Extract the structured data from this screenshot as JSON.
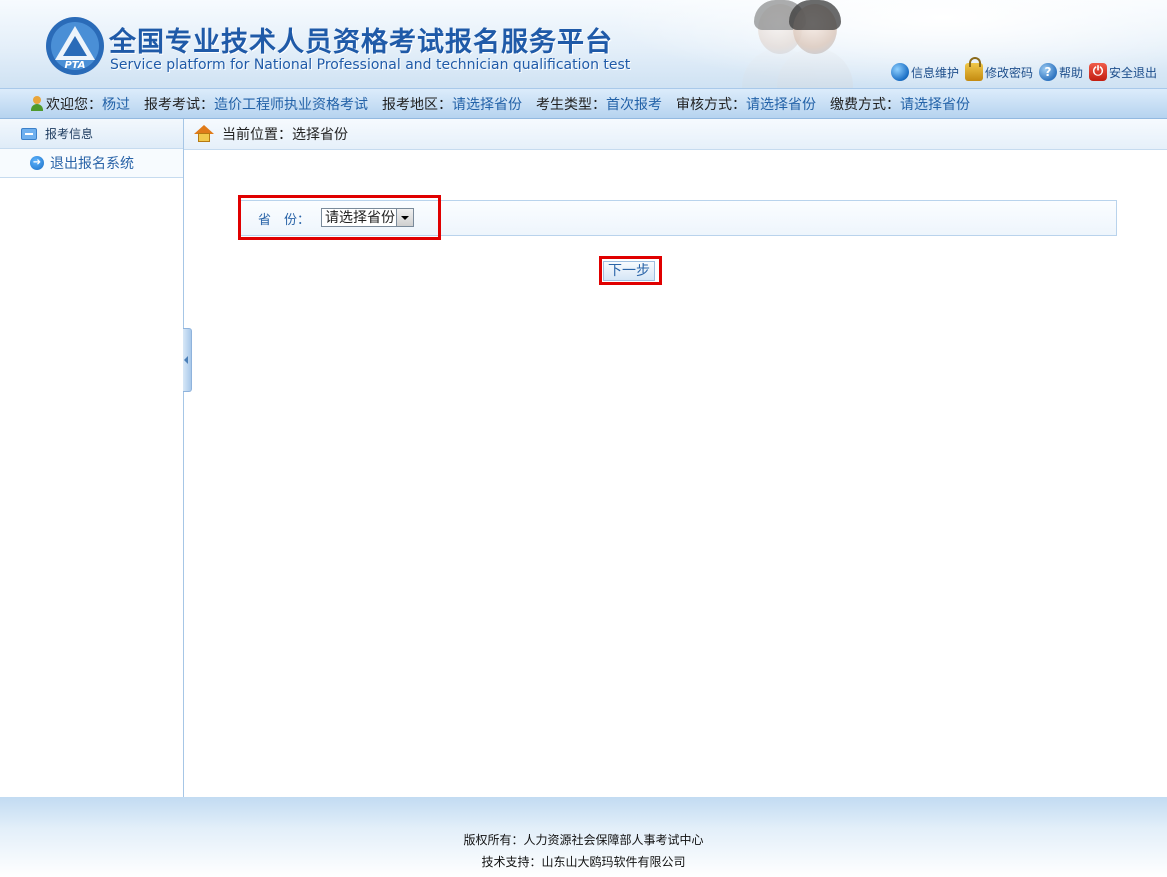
{
  "header": {
    "title": "全国专业技术人员资格考试报名服务平台",
    "subtitle": "Service platform for National Professional and technician qualification test",
    "logo_text": "PTA",
    "links": [
      {
        "icon": "globe-icon",
        "label": "信息维护"
      },
      {
        "icon": "lock-icon",
        "label": "修改密码"
      },
      {
        "icon": "help-icon",
        "label": "帮助"
      },
      {
        "icon": "power-icon",
        "label": "安全退出"
      }
    ]
  },
  "infobar": {
    "welcome_label": "欢迎您：",
    "welcome_value": "杨过",
    "exam_label": "报考考试：",
    "exam_value": "造价工程师执业资格考试",
    "region_label": "报考地区：",
    "region_value": "请选择省份",
    "candidate_label": "考生类型：",
    "candidate_value": "首次报考",
    "review_label": "审核方式：",
    "review_value": "请选择省份",
    "payment_label": "缴费方式：",
    "payment_value": "请选择省份"
  },
  "sidebar": {
    "header": "报考信息",
    "items": [
      {
        "label": "退出报名系统"
      }
    ]
  },
  "main": {
    "breadcrumb": "当前位置：选择省份",
    "province_label": "省　份：",
    "province_selected": "请选择省份",
    "next_button": "下一步"
  },
  "footer": {
    "copyright": "版权所有：人力资源社会保障部人事考试中心",
    "support": "技术支持：山东山大鸥玛软件有限公司"
  },
  "colors": {
    "accent": "#2a64a8",
    "highlight": "#e00000"
  }
}
